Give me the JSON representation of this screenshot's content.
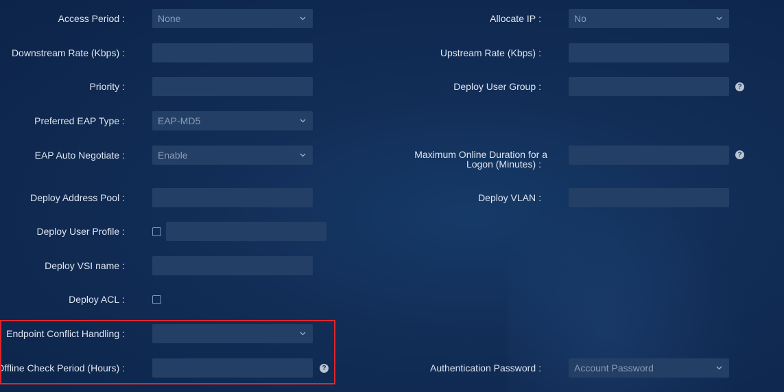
{
  "left": {
    "access_period": {
      "label": "Access Period",
      "value": "None"
    },
    "downstream_rate": {
      "label": "Downstream Rate (Kbps)",
      "value": ""
    },
    "priority": {
      "label": "Priority",
      "value": ""
    },
    "preferred_eap": {
      "label": "Preferred EAP Type",
      "value": "EAP-MD5"
    },
    "eap_auto": {
      "label": "EAP Auto Negotiate",
      "value": "Enable"
    },
    "address_pool": {
      "label": "Deploy Address Pool",
      "value": ""
    },
    "user_profile": {
      "label": "Deploy User Profile",
      "value": ""
    },
    "vsi_name": {
      "label": "Deploy VSI name",
      "value": ""
    },
    "acl": {
      "label": "Deploy ACL"
    },
    "endpoint_conflict": {
      "label": "Endpoint Conflict Handling",
      "value": ""
    },
    "offline_check": {
      "label": "Offline Check Period (Hours)",
      "value": ""
    }
  },
  "right": {
    "allocate_ip": {
      "label": "Allocate IP",
      "value": "No"
    },
    "upstream_rate": {
      "label": "Upstream Rate (Kbps)",
      "value": ""
    },
    "user_group": {
      "label": "Deploy User Group",
      "value": ""
    },
    "max_online_line1": "Maximum Online Duration for a",
    "max_online_line2": "Logon (Minutes)",
    "max_online_value": "",
    "vlan": {
      "label": "Deploy VLAN",
      "value": ""
    },
    "auth_password": {
      "label": "Authentication Password",
      "value": "Account Password"
    }
  },
  "colon": ":",
  "help_glyph": "?",
  "icons": {
    "dropdown": "chevron-down-icon",
    "help": "help-icon",
    "checkbox": "checkbox"
  },
  "colors": {
    "background": "#112c55",
    "field": "#233f66",
    "highlight": "#e0262b"
  }
}
